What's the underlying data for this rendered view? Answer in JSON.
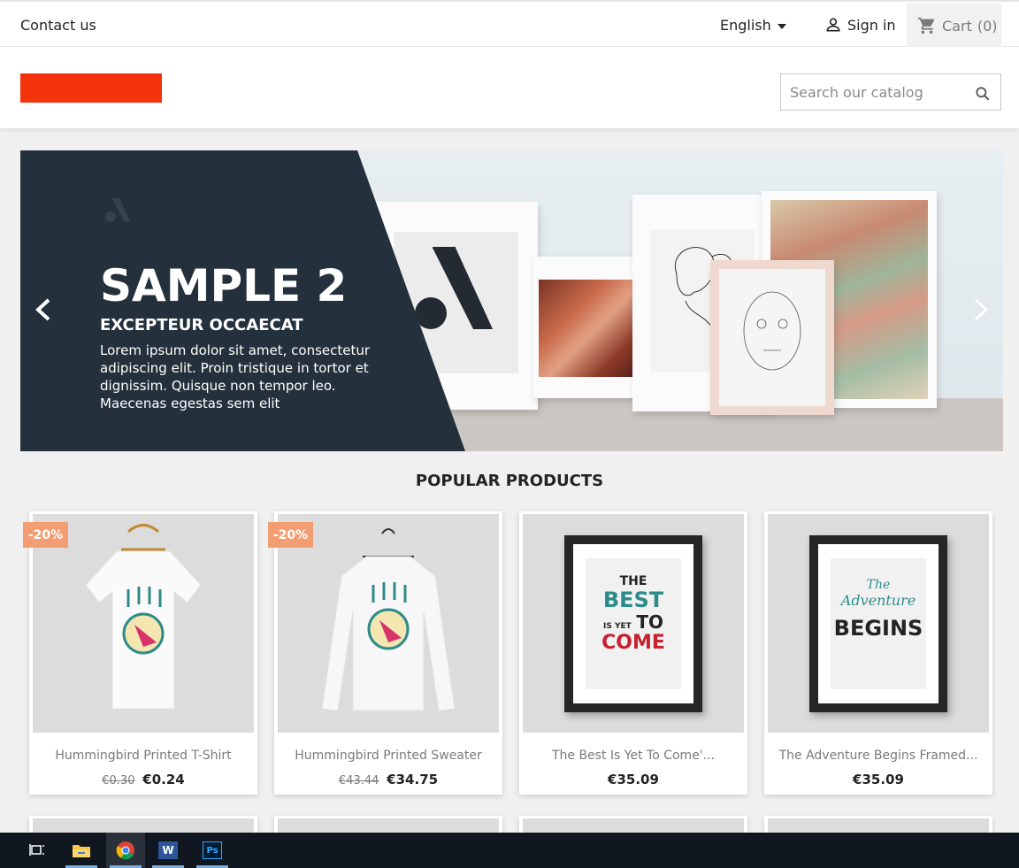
{
  "topbar": {
    "contact_label": "Contact us",
    "language_label": "English",
    "signin_label": "Sign in",
    "cart_label": "Cart",
    "cart_count": "(0)"
  },
  "header": {
    "logo_color": "#f3330b",
    "search_placeholder": "Search our catalog"
  },
  "carousel": {
    "title": "SAMPLE 2",
    "subtitle": "EXCEPTEUR OCCAECAT",
    "text": "Lorem ipsum dolor sit amet, consectetur adipiscing elit. Proin tristique in tortor et dignissim. Quisque non tempor leo. Maecenas egestas sem elit",
    "panel_color": "#24313c"
  },
  "popular": {
    "title": "POPULAR PRODUCTS",
    "products": [
      {
        "name": "Hummingbird Printed T-Shirt",
        "old_price": "€0.30",
        "price": "€0.24",
        "badge": "-20%"
      },
      {
        "name": "Hummingbird Printed Sweater",
        "old_price": "€43.44",
        "price": "€34.75",
        "badge": "-20%"
      },
      {
        "name": "The Best Is Yet To Come'...",
        "old_price": "",
        "price": "€35.09",
        "badge": ""
      },
      {
        "name": "The Adventure Begins Framed...",
        "old_price": "",
        "price": "€35.09",
        "badge": ""
      }
    ],
    "poster1": {
      "l1": "THE",
      "l2": "BEST",
      "l3": "IS YET",
      "l4": "TO",
      "l5": "COME"
    },
    "poster2": {
      "l1": "The",
      "l2": "Adventure",
      "l3": "BEGINS"
    }
  },
  "colors": {
    "badge": "#f39d72",
    "accent_teal": "#2d8c8a",
    "accent_red": "#c8202e"
  },
  "taskbar": {
    "icons": [
      "task-view-icon",
      "file-explorer-icon",
      "chrome-icon",
      "word-icon",
      "photoshop-icon"
    ],
    "word_letter": "W",
    "ps_letters": "Ps"
  }
}
